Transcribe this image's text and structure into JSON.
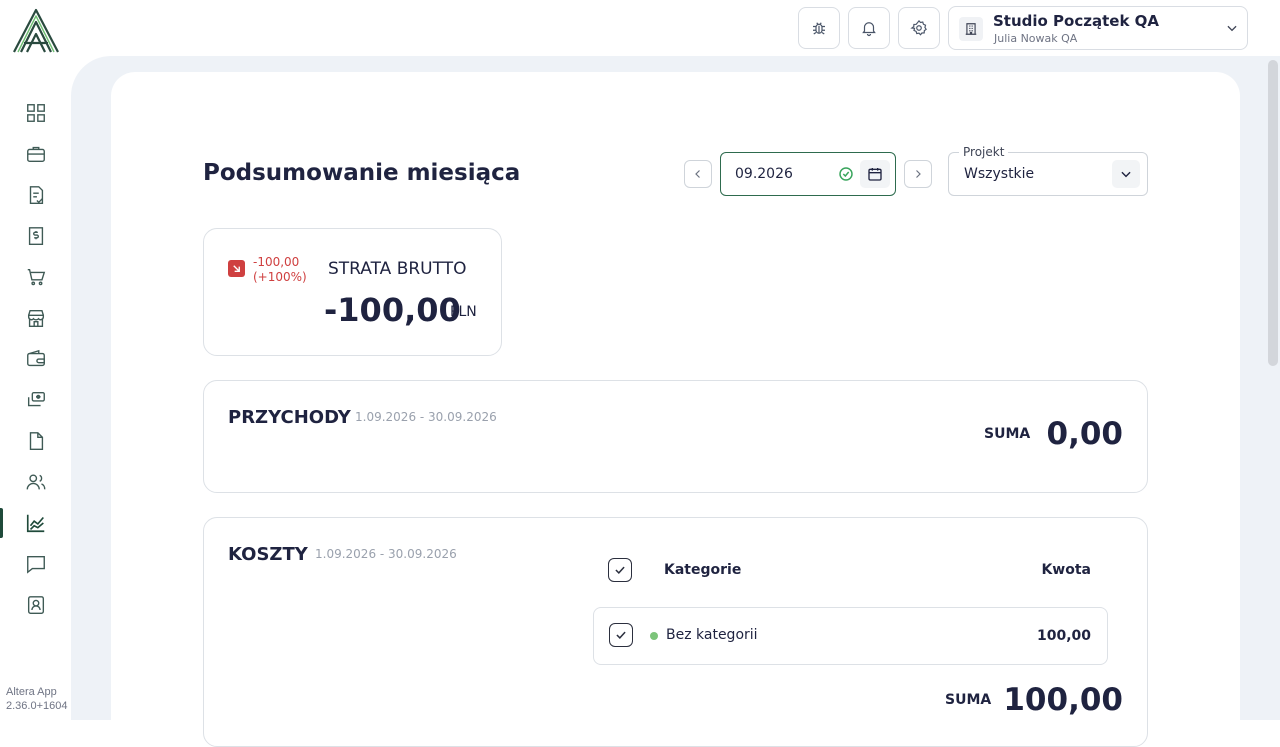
{
  "app": {
    "version_name": "Altera App",
    "version_number": "2.36.0+1604"
  },
  "header": {
    "company_name": "Studio Początek QA",
    "user_name": "Julia Nowak QA"
  },
  "page": {
    "title": "Podsumowanie miesiąca"
  },
  "filters": {
    "month_value": "09.2026",
    "project_label": "Projekt",
    "project_value": "Wszystkie"
  },
  "summary": {
    "change_value": "-100,00",
    "change_percent": "(+100%)",
    "title": "STRATA BRUTTO",
    "value": "-100,00",
    "currency": "PLN"
  },
  "income": {
    "title": "PRZYCHODY",
    "range": "1.09.2026 - 30.09.2026",
    "sum_label": "SUMA",
    "sum_value": "0,00"
  },
  "costs": {
    "title": "KOSZTY",
    "range": "1.09.2026 - 30.09.2026",
    "col_category": "Kategorie",
    "col_amount": "Kwota",
    "rows": [
      {
        "name": "Bez kategorii",
        "amount": "100,00",
        "dot_color": "#7cc47a"
      }
    ],
    "sum_label": "SUMA",
    "sum_value": "100,00"
  },
  "colors": {
    "brand": "#1f4a3a",
    "loss": "#cf4040",
    "success": "#3aa55d",
    "background": "#eef2f7"
  },
  "icons": {
    "nav": [
      "dashboard-icon",
      "briefcase-icon",
      "invoice-icon",
      "cost-document-icon",
      "cart-icon",
      "store-icon",
      "wallet-icon",
      "payments-icon",
      "file-icon",
      "users-icon",
      "chart-icon",
      "chat-icon",
      "contact-icon"
    ],
    "topbar": [
      "bug-icon",
      "bell-icon",
      "gear-icon"
    ]
  }
}
